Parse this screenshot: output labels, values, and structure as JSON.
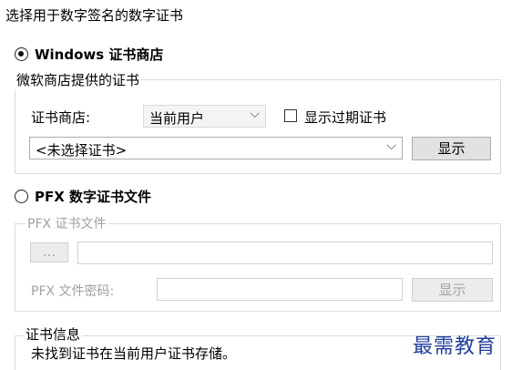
{
  "dialog": {
    "heading": "选择用于数字签名的数字证书"
  },
  "windows_store": {
    "radio_label": "Windows 证书商店",
    "group_title": "微软商店提供的证书",
    "store_label": "证书商店:",
    "store_value": "当前用户",
    "show_expired_label": "显示过期证书",
    "cert_combo_value": "<未选择证书>",
    "show_button": "显示"
  },
  "pfx": {
    "radio_label": "PFX 数字证书文件",
    "group_title": "PFX 证书文件",
    "browse_button": "...",
    "password_label": "PFX 文件密码:",
    "show_button": "显示"
  },
  "cert_info": {
    "group_title": "证书信息",
    "message": "未找到证书在当前用户证书存储。"
  },
  "watermark": "最需教育"
}
